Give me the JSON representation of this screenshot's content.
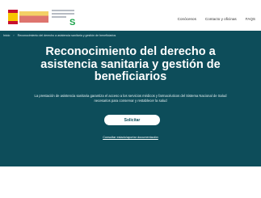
{
  "header": {
    "nav_items": [
      "Conócenos",
      "Contacto y oficinas",
      "FAQS"
    ]
  },
  "breadcrumb": [
    "Inicio",
    "Reconocimiento del derecho a asistencia sanitaria y gestión de beneficiarios"
  ],
  "hero": {
    "title": "Reconocimiento del derecho a asistencia sanitaria y gestión de beneficiarios",
    "description": "La prestación de asistencia sanitaria garantiza el acceso a los servicios médicos y farmacéuticos del Sistema Nacional de Salud necesarios para conservar y restablecer la salud",
    "button_label": "Solicitar",
    "link_label": "Consultar estado/aportar documentación"
  },
  "colors": {
    "hero_bg": "#0d4d5a",
    "button_bg": "#ffffff"
  }
}
